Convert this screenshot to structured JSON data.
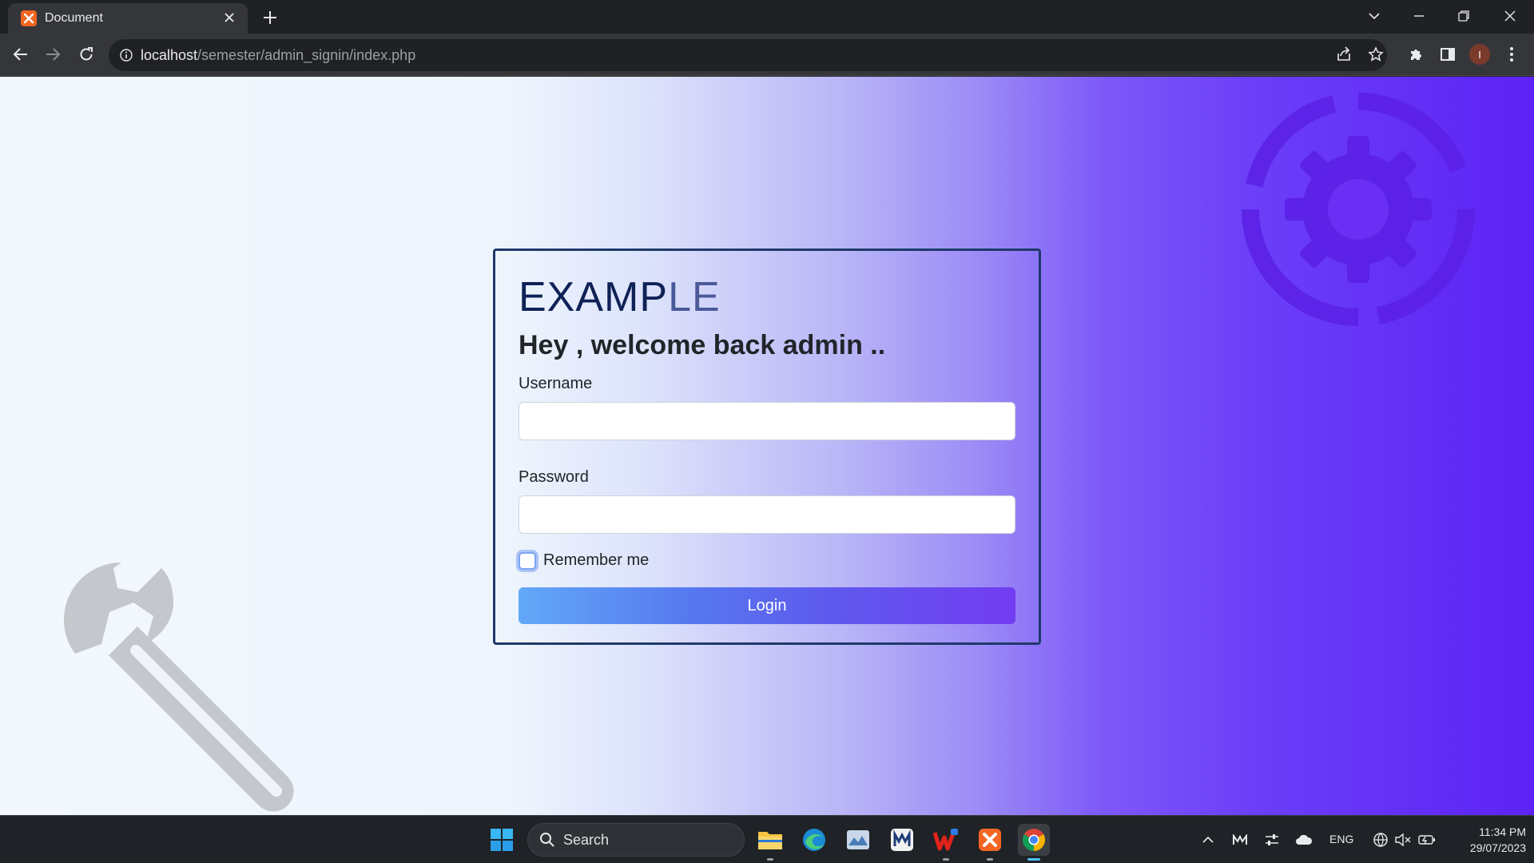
{
  "browser": {
    "tab_title": "Document",
    "url_host": "localhost",
    "url_path": "/semester/admin_signin/index.php",
    "profile_initial": "I"
  },
  "page": {
    "brand_part1": "EXAMP",
    "brand_part2": "LE",
    "welcome": "Hey , welcome back admin ..",
    "username_label": "Username",
    "password_label": "Password",
    "remember_label": "Remember me",
    "login_label": "Login",
    "username_value": "",
    "password_value": ""
  },
  "taskbar": {
    "search_label": "Search",
    "language": "ENG",
    "time": "11:34 PM",
    "date": "29/07/2023"
  },
  "colors": {
    "brand_dark": "#0f2257",
    "brand_light": "#4b5a99",
    "card_border": "#1d3a6a",
    "button_start": "#62a8f8",
    "button_end": "#733cf1",
    "background_right": "#5d23f5"
  },
  "icons": [
    "xampp-icon",
    "close-icon",
    "plus-icon",
    "chevron-down-icon",
    "minimize-icon",
    "restore-icon",
    "back-arrow-icon",
    "forward-arrow-icon",
    "reload-icon",
    "info-icon",
    "share-icon",
    "star-icon",
    "puzzle-icon",
    "side-panel-icon",
    "kebab-menu-icon",
    "gear-icon",
    "wrench-icon",
    "windows-start-icon",
    "search-icon",
    "file-explorer-icon",
    "edge-icon",
    "chrome-icon",
    "wps-icon",
    "wifi-icon",
    "volume-mute-icon",
    "battery-icon"
  ]
}
